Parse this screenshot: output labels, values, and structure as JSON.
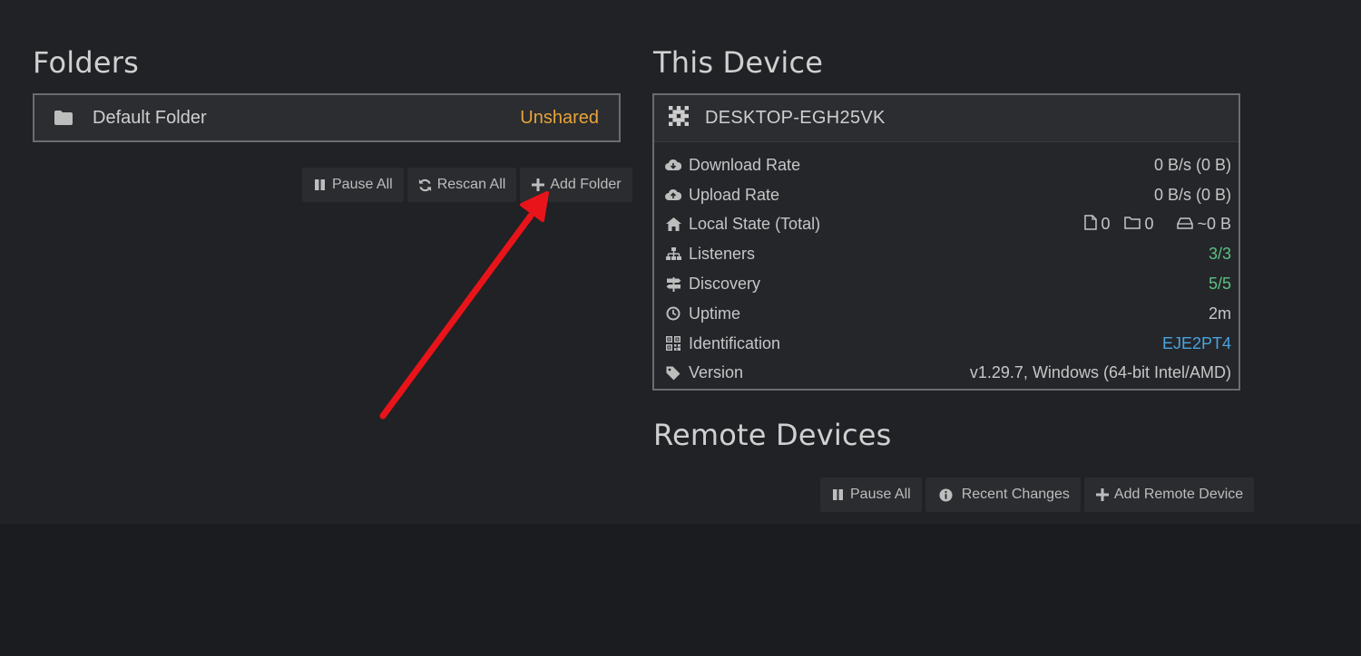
{
  "folders": {
    "title": "Folders",
    "items": [
      {
        "name": "Default Folder",
        "status": "Unshared",
        "icon": "folder-icon"
      }
    ],
    "actions": {
      "pause_all": "Pause All",
      "rescan_all": "Rescan All",
      "add_folder": "Add Folder"
    }
  },
  "this_device": {
    "title": "This Device",
    "name": "DESKTOP-EGH25VK",
    "stats": [
      {
        "label": "Download Rate",
        "value": "0 B/s (0 B)",
        "icon": "cloud-download-icon"
      },
      {
        "label": "Upload Rate",
        "value": "0 B/s (0 B)",
        "icon": "cloud-upload-icon"
      },
      {
        "label": "Local State (Total)",
        "icon": "home-icon",
        "files": "0",
        "dirs": "0",
        "size": "~0 B"
      },
      {
        "label": "Listeners",
        "value": "3/3",
        "icon": "sitemap-icon"
      },
      {
        "label": "Discovery",
        "value": "5/5",
        "icon": "signpost-icon"
      },
      {
        "label": "Uptime",
        "value": "2m",
        "icon": "clock-icon"
      },
      {
        "label": "Identification",
        "value": "EJE2PT4",
        "icon": "qrcode-icon"
      },
      {
        "label": "Version",
        "value": "v1.29.7, Windows (64-bit Intel/AMD)",
        "icon": "tag-icon"
      }
    ]
  },
  "remote_devices": {
    "title": "Remote Devices",
    "actions": {
      "pause_all": "Pause All",
      "recent_changes": "Recent Changes",
      "add_remote_device": "Add Remote Device"
    }
  },
  "colors": {
    "background": "#202225",
    "panel": "#2b2d30",
    "unshared": "#e8a43a",
    "ok_green": "#5cc080",
    "link_blue": "#4aa3df",
    "annotation_arrow": "#e8141a"
  }
}
